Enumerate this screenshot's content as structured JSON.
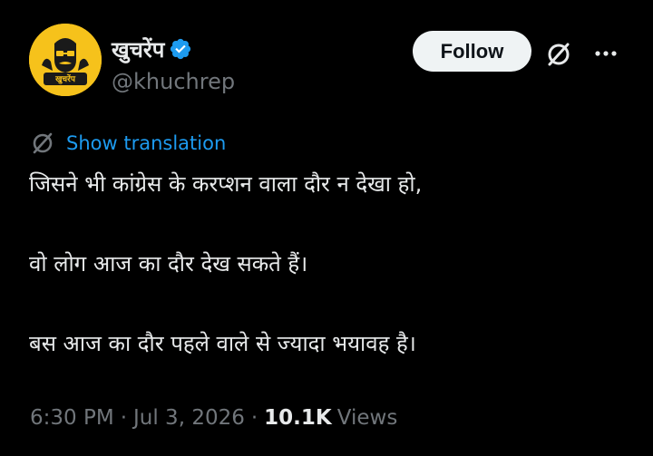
{
  "author": {
    "display_name": "खुचरेंप",
    "handle": "@khuchrep",
    "avatar_text": "खुचरेंप",
    "avatar_color": "#f6c21b",
    "verified": true,
    "verified_color": "#1d9bf0"
  },
  "actions": {
    "follow_label": "Follow",
    "grok_icon": "grok-slash-circle-icon",
    "more_icon": "more-dots-icon"
  },
  "translation": {
    "icon": "globe-slash-icon",
    "label": "Show translation",
    "link_color": "#1d9bf0"
  },
  "tweet": {
    "lines": [
      "जिसने भी कांग्रेस के करप्शन वाला दौर न देखा हो,",
      "वो लोग आज का दौर देख सकते हैं।",
      "बस आज का दौर पहले वाले से ज्यादा भयावह है।"
    ]
  },
  "meta": {
    "time": "6:30 PM",
    "separator": "·",
    "date": "Jul 3, 2026",
    "views_count": "10.1K",
    "views_label": "Views"
  }
}
